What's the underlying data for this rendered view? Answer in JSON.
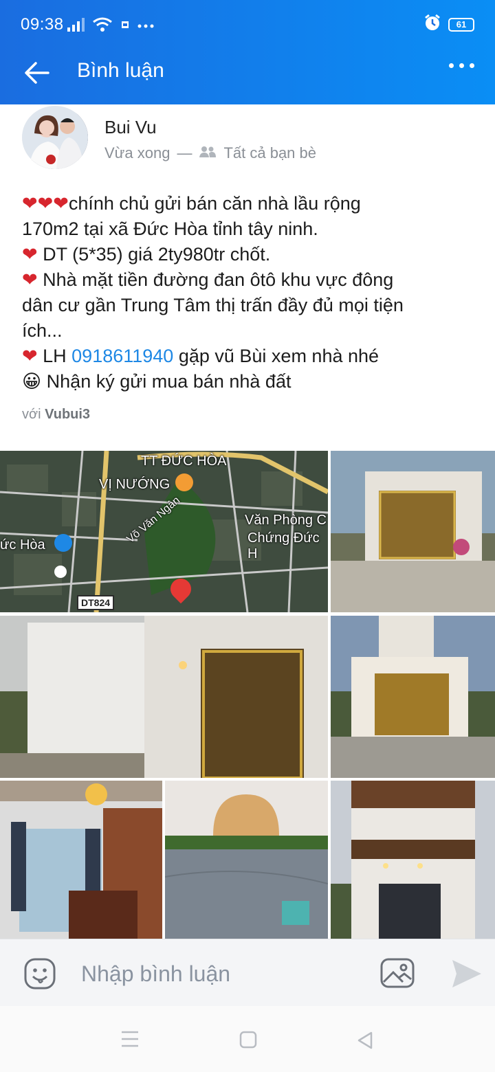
{
  "status_bar": {
    "time": "09:38",
    "battery": "61",
    "icons": [
      "signal-icon",
      "wifi-icon",
      "notification-icon",
      "more-dots-icon",
      "alarm-icon",
      "battery-icon"
    ]
  },
  "app_bar": {
    "title": "Bình luận",
    "back_icon": "back-arrow-icon",
    "more_icon": "more-horizontal-icon"
  },
  "post": {
    "author": "Bui Vu",
    "time": "Vừa xong",
    "separator": "—",
    "privacy": "Tất cả bạn bè",
    "lines": [
      {
        "prefix": "❤❤❤",
        "text": "chính chủ gửi bán căn nhà lầu rộng"
      },
      {
        "prefix": "",
        "text": "170m2 tại xã Đức Hòa tỉnh tây ninh."
      },
      {
        "prefix": "❤",
        "text": " DT (5*35) giá 2ty980tr chốt."
      },
      {
        "prefix": "❤",
        "text": " Nhà mặt tiền đường đan ôtô khu vực đông"
      },
      {
        "prefix": "",
        "text": "dân cư gần Trung Tâm thị trấn đầy đủ mọi tiện"
      },
      {
        "prefix": "",
        "text": "ích..."
      }
    ],
    "contact_prefix": "❤",
    "contact_label": " LH ",
    "phone": "0918611940",
    "contact_suffix": " gặp vũ Bùi xem nhà nhé",
    "last_line_emoji": "😀",
    "last_line": " Nhận ký gửi mua bán nhà đất",
    "tag_prefix": "với",
    "tag_name": "Vubui3"
  },
  "map": {
    "labels": {
      "town": "TT ĐỨC HÒA",
      "restaurant": "VỊ NƯỚNG",
      "street": "Võ Văn Ngân",
      "office_1": "Văn Phòng C",
      "office_2": "Chứng Đức H",
      "left": "ức Hòa",
      "road": "DT824"
    }
  },
  "photos": [
    "map",
    "gate-front",
    "side-wall",
    "house-evening",
    "living-room",
    "garden",
    "facade-night"
  ],
  "comment_bar": {
    "placeholder": "Nhập bình luận",
    "emoji_icon": "sticker-icon",
    "image_icon": "image-icon",
    "send_icon": "send-icon"
  },
  "nav_bar": {
    "icons": [
      "menu-icon",
      "home-square-icon",
      "back-triangle-icon"
    ]
  },
  "colors": {
    "brand": "#1a6de0",
    "link": "#1e88e5",
    "heart": "#d7262e"
  }
}
